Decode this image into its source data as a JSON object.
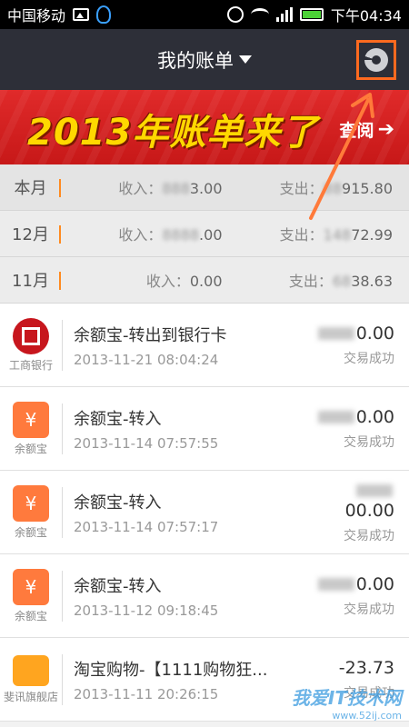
{
  "status_bar": {
    "carrier": "中国移动",
    "time": "下午04:34",
    "icons": [
      "image-icon",
      "qq-icon",
      "alarm-icon",
      "wifi-icon",
      "signal-icon",
      "battery-icon"
    ]
  },
  "header": {
    "title": "我的账单",
    "chart_button_icon": "pie-chart-icon",
    "highlight_color": "#ff6a1f"
  },
  "banner": {
    "text": "2013年账单来了",
    "link": "查阅"
  },
  "months": [
    {
      "label": "本月",
      "income_label": "收入：",
      "income_value": "3.00",
      "expense_label": "支出：",
      "expense_value": "915.80"
    },
    {
      "label": "12月",
      "income_label": "收入：",
      "income_value": ".00",
      "expense_label": "支出：",
      "expense_value": "72.99"
    },
    {
      "label": "11月",
      "income_label": "收入：",
      "income_value": "0.00",
      "expense_label": "支出：",
      "expense_value": "38.63"
    }
  ],
  "transactions": [
    {
      "logo": "icbc-icon",
      "logo_label": "工商银行",
      "title": "余额宝-转出到银行卡",
      "time": "2013-11-21 08:04:24",
      "amount": "0.00",
      "status": "交易成功"
    },
    {
      "logo": "money-bag-icon",
      "logo_label": "余额宝",
      "title": "余额宝-转入",
      "time": "2013-11-14 07:57:55",
      "amount": "0.00",
      "status": "交易成功"
    },
    {
      "logo": "money-bag-icon",
      "logo_label": "余额宝",
      "title": "余额宝-转入",
      "time": "2013-11-14 07:57:17",
      "amount": "00.00",
      "status": "交易成功"
    },
    {
      "logo": "money-bag-icon",
      "logo_label": "余额宝",
      "title": "余额宝-转入",
      "time": "2013-11-12 09:18:45",
      "amount": "0.00",
      "status": "交易成功"
    },
    {
      "logo": "shop-icon",
      "logo_label": "斐讯旗舰店",
      "title": "淘宝购物-【1111购物狂...",
      "time": "2013-11-11 20:26:15",
      "amount": "-23.73",
      "status": "交易成功"
    }
  ],
  "watermark": {
    "main": "我爱IT技术网",
    "sub": "www.52ij.com"
  }
}
